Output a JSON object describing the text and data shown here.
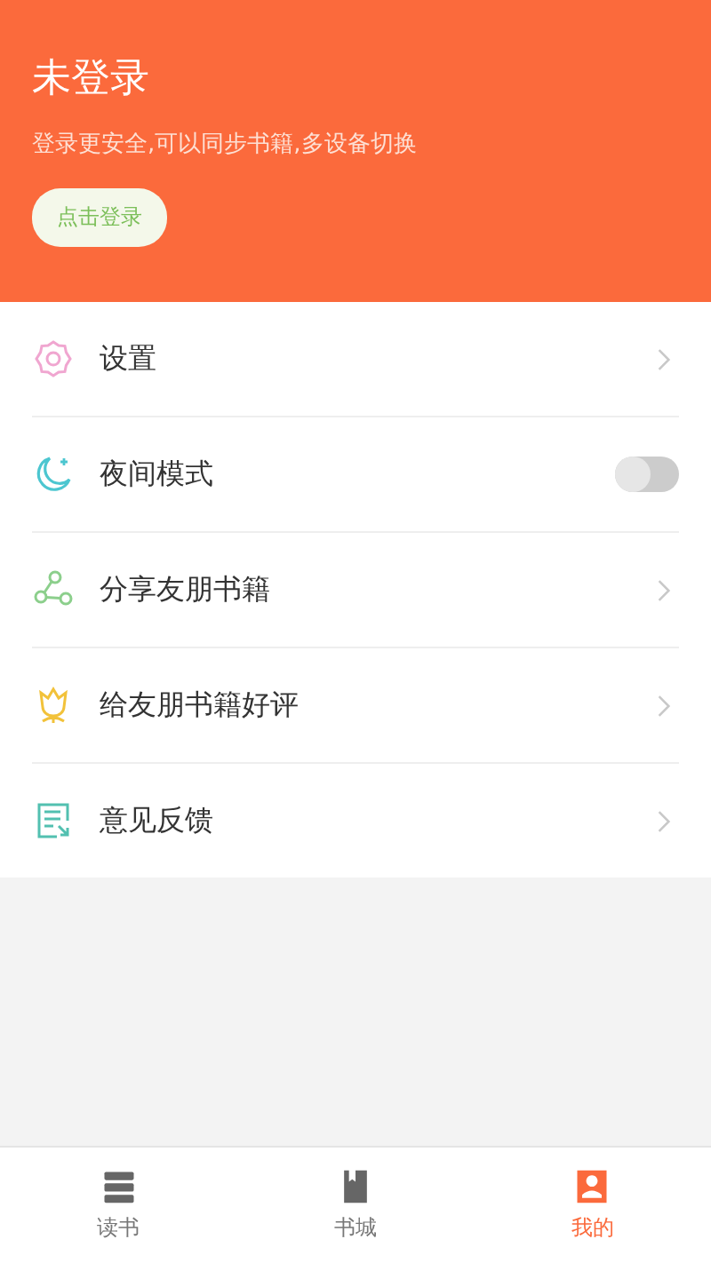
{
  "header": {
    "title": "未登录",
    "subtitle": "登录更安全,可以同步书籍,多设备切换",
    "login_button": "点击登录"
  },
  "menu": [
    {
      "label": "设置",
      "kind": "link"
    },
    {
      "label": "夜间模式",
      "kind": "toggle",
      "on": false
    },
    {
      "label": "分享友朋书籍",
      "kind": "link"
    },
    {
      "label": "给友朋书籍好评",
      "kind": "link"
    },
    {
      "label": "意见反馈",
      "kind": "link"
    }
  ],
  "tabs": [
    {
      "label": "读书",
      "selected": false
    },
    {
      "label": "书城",
      "selected": false
    },
    {
      "label": "我的",
      "selected": true
    }
  ]
}
